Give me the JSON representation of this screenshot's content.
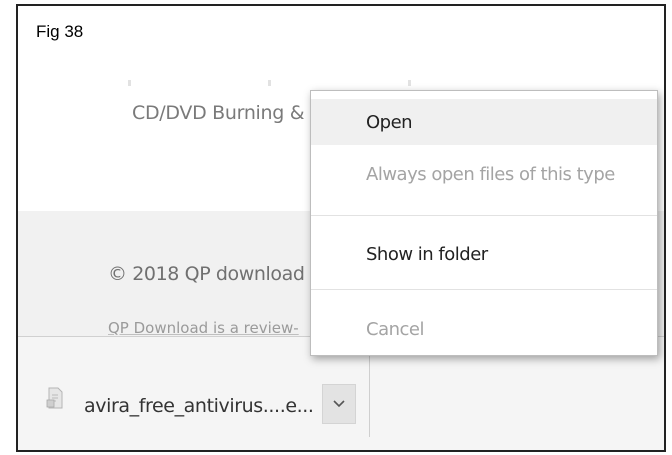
{
  "figure": {
    "label": "Fig 38"
  },
  "page": {
    "cd_title": "CD/DVD Burning &",
    "copyright": "© 2018 QP download",
    "footer_desc": "QP Download is a review-"
  },
  "download_shelf": {
    "file_name": "avira_free_antivirus....e...",
    "file_icon": "installer-file-icon",
    "menu_button_icon": "chevron-down-icon"
  },
  "context_menu": {
    "items": [
      {
        "label": "Open",
        "enabled": true,
        "highlighted": true
      },
      {
        "label": "Always open files of this type",
        "enabled": false
      },
      {
        "label": "Show in folder",
        "enabled": true
      },
      {
        "label": "Cancel",
        "enabled": false
      }
    ]
  },
  "colors": {
    "footer_bg": "#f1f1f1",
    "menu_bg": "#ffffff",
    "highlight": "#f0f0f0",
    "disabled_text": "#a4a4a4"
  }
}
